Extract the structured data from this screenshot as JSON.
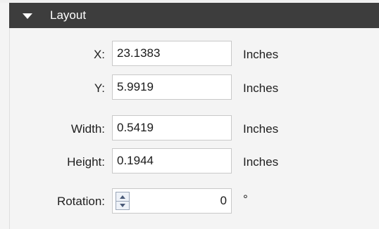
{
  "section": {
    "title": "Layout",
    "collapse_icon": "triangle-down-icon"
  },
  "fields": {
    "x": {
      "label": "X:",
      "value": "23.1383",
      "unit": "Inches"
    },
    "y": {
      "label": "Y:",
      "value": "5.9919",
      "unit": "Inches"
    },
    "width": {
      "label": "Width:",
      "value": "0.5419",
      "unit": "Inches"
    },
    "height": {
      "label": "Height:",
      "value": "0.1944",
      "unit": "Inches"
    },
    "rotation": {
      "label": "Rotation:",
      "value": "0",
      "unit": "°"
    }
  },
  "colors": {
    "header_bg": "#3d3d3d",
    "panel_bg": "#f4f4f4",
    "input_border": "#c9c9c9"
  }
}
